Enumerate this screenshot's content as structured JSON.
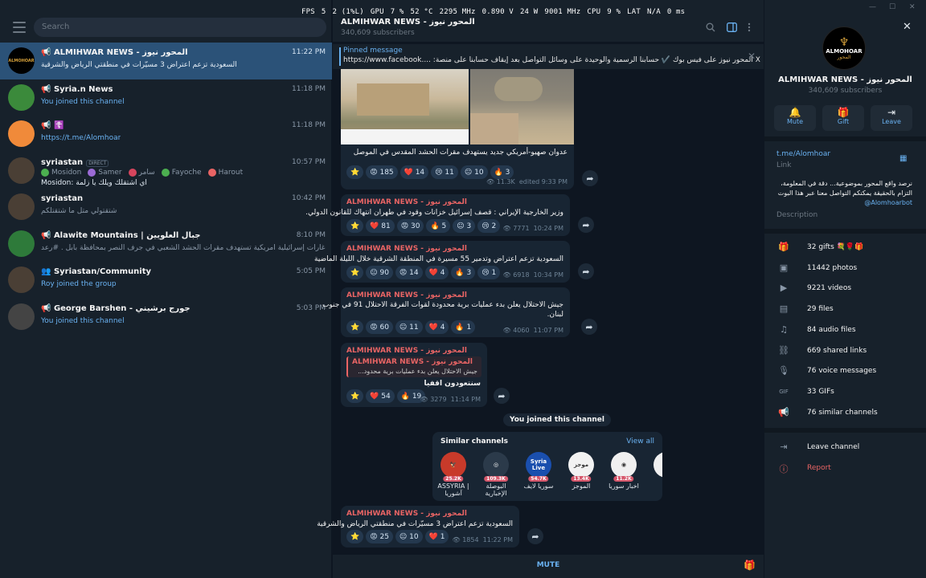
{
  "osd": [
    "FPS",
    "5",
    "2 (1%L)",
    "GPU",
    "7 %",
    "52 °C",
    "2295 MHz",
    "0.890 V",
    "24 W",
    "9001 MHz",
    "CPU",
    "9 %",
    "LAT",
    "N/A",
    "0 ms"
  ],
  "sidebar": {
    "search_placeholder": "Search",
    "chats": [
      {
        "name": "ALMIHWAR NEWS - المحور نيوز",
        "time": "11:22 PM",
        "msg": "السعودية تزعم اعتراض 3 مسيّرات في منطقتي الرياض والشرقية",
        "avatar_text": "ALMOHOAR",
        "avatar_color": "#000000"
      },
      {
        "name": "Syria.n News",
        "time": "11:18 PM",
        "msg": "You joined this channel",
        "avatar_text": "",
        "avatar_color": "#3b8a3b"
      },
      {
        "name": "☦️",
        "time": "11:18 PM",
        "msg": "https://t.me/Alomhoar",
        "avatar_text": "",
        "avatar_color": "#f08a3a"
      },
      {
        "name": "syriastan",
        "badge": "DIRECT",
        "time": "10:57 PM",
        "msg1": "Mosidon",
        "msg2": "Samer",
        "msg3": "سامر",
        "msg4": "Fayoche",
        "msg5": "Harout",
        "msg": "Mosidon: اي اشتقلك ويلك يا زلمة",
        "avatar_text": "",
        "avatar_color": "#4a3f35"
      },
      {
        "name": "syriastan",
        "time": "10:42 PM",
        "msg": "شتقتولي متل ما شتقتلكم",
        "avatar_text": "",
        "avatar_color": "#4a3f35"
      },
      {
        "name": "Alawite Mountains | جبال العلويين",
        "time": "8:10 PM",
        "msg": "متابعة : غارات إسرائيلية امريكية تستهدف مقرات الحشد الشعبي في جرف النصر بمحافظة بابل . #رعد",
        "avatar_text": "",
        "avatar_color": "#2e7a3a"
      },
      {
        "name": "Syriastan/Community",
        "time": "5:05 PM",
        "msg": "Roy joined the group",
        "avatar_text": "",
        "avatar_color": "#4a3f35"
      },
      {
        "name": "George Barshen - جورج برشيني",
        "time": "5:03 PM",
        "msg": "You joined this channel",
        "avatar_text": "",
        "avatar_color": "#444444"
      }
    ]
  },
  "chat": {
    "title": "ALMIHWAR NEWS - المحور نيوز",
    "subscribers": "340,609 subscribers",
    "pinned_label": "Pinned message",
    "pinned_text": "https://www.facebook.... :المحور نيوز على فيس بوك ✔️ حسابنا الرسمية والوحيدة على وسائل التواصل بعد إيقاف حسابنا على منصة X",
    "sender": "ALMIHWAR NEWS - المحور نيوز",
    "msg1": {
      "text": "عدوان صهيو-أمريكي جديد يستهدف مقرات الحشد المقدس في الموصل",
      "reactions": [
        "⭐",
        "😡 185",
        "❤️ 14",
        "😢 11",
        "😐 10",
        "🔥 3"
      ],
      "views": "11.3K",
      "time": "edited 9:33 PM"
    },
    "msg2": {
      "text": "وزير الخارجية الإيراني : قصف إسرائيل خزانات وقود في طهران انتهاك للقانون الدولي.",
      "reactions": [
        "⭐",
        "❤️ 81",
        "😡 30",
        "🔥 5",
        "😐 3",
        "😢 2"
      ],
      "views": "7771",
      "time": "10:24 PM"
    },
    "msg3": {
      "text": "السعودية تزعم اعتراض وتدمير 55 مسيرة في المنطقة الشرقية خلال الليلة الماضية",
      "reactions": [
        "⭐",
        "😐 90",
        "😡 14",
        "❤️ 4",
        "🔥 3",
        "😢 1"
      ],
      "views": "6918",
      "time": "10:34 PM"
    },
    "msg4": {
      "line1": "جيش الاحتلال يعلن بدء عمليات برية محدودة لقوات الفرقة الاحتلال 91 في جنوب",
      "line2": "لبنان.",
      "reactions": [
        "⭐",
        "😡 60",
        "😐 11",
        "❤️ 4",
        "🔥 1"
      ],
      "views": "4060",
      "time": "11:07 PM"
    },
    "msg5": {
      "quote_sender": "ALMIHWAR NEWS - المحور نيوز",
      "quote_text": "جيش الاحتلال يعلن بدء عمليات برية محدود...",
      "text": "سنتعودون اقفيا",
      "reactions": [
        "⭐",
        "❤️ 54",
        "🔥 19"
      ],
      "views": "3279",
      "time": "11:14 PM"
    },
    "joined_notice": "You joined this channel",
    "similar": {
      "title": "Similar channels",
      "view_all": "View all",
      "items": [
        {
          "name1": "ASSYRIA |",
          "name2": "آشوريا",
          "count": "25.2K",
          "color": "#c83a2a",
          "mark": "🦅"
        },
        {
          "name1": "البوصلة",
          "name2": "الإخبارية",
          "count": "109.3K",
          "color": "#2b3a4a",
          "mark": "◎"
        },
        {
          "name1": "سوريا لايف",
          "name2": "",
          "count": "54.7K",
          "color": "#1a4fae",
          "mark": "Syria Live"
        },
        {
          "name1": "الموجز",
          "name2": "",
          "count": "13.4K",
          "color": "#f2f2f2",
          "mark": "موجز"
        },
        {
          "name1": "اخبار سوريا",
          "name2": "",
          "count": "11.2K",
          "color": "#f0f0f0",
          "mark": "◉"
        },
        {
          "name1": "Sy",
          "name2": "",
          "count": "",
          "color": "#f0f0f0",
          "mark": ""
        }
      ]
    },
    "msg6": {
      "text": "السعودية تزعم اعتراض 3 مسيّرات في منطقتي الرياض والشرقية",
      "reactions": [
        "⭐",
        "😡 25",
        "😐 10",
        "❤️ 1"
      ],
      "views": "1854",
      "time": "11:22 PM"
    },
    "mute": "MUTE"
  },
  "panel": {
    "logo_text": "ALMOHOAR",
    "logo_sub": "المحور",
    "title": "ALMIHWAR NEWS - المحور نيوز",
    "subscribers": "340,609 subscribers",
    "actions": [
      "Mute",
      "Gift",
      "Leave"
    ],
    "link": "t.me/Alomhoar",
    "link_label": "Link",
    "desc1": "نرصد واقع المحور بموضوعية... دقة في المعلومة،",
    "desc2": "التزام بالحقيقة يمكنكم التواصل معنا عبر هذا البوت",
    "desc3": "@Alomhoarbot",
    "desc_label": "Description",
    "media": [
      {
        "icon": "gift-icon",
        "label": "32 gifts 💐🌹🎁"
      },
      {
        "icon": "photo-icon",
        "label": "11442 photos"
      },
      {
        "icon": "video-icon",
        "label": "9221 videos"
      },
      {
        "icon": "file-icon",
        "label": "29 files"
      },
      {
        "icon": "audio-icon",
        "label": "84 audio files"
      },
      {
        "icon": "link-icon",
        "label": "669 shared links"
      },
      {
        "icon": "mic-icon",
        "label": "76 voice messages"
      },
      {
        "icon": "gif-icon",
        "label": "33 GIFs"
      },
      {
        "icon": "megaphone-icon",
        "label": "76 similar channels"
      }
    ],
    "leave": "Leave channel",
    "report": "Report"
  }
}
